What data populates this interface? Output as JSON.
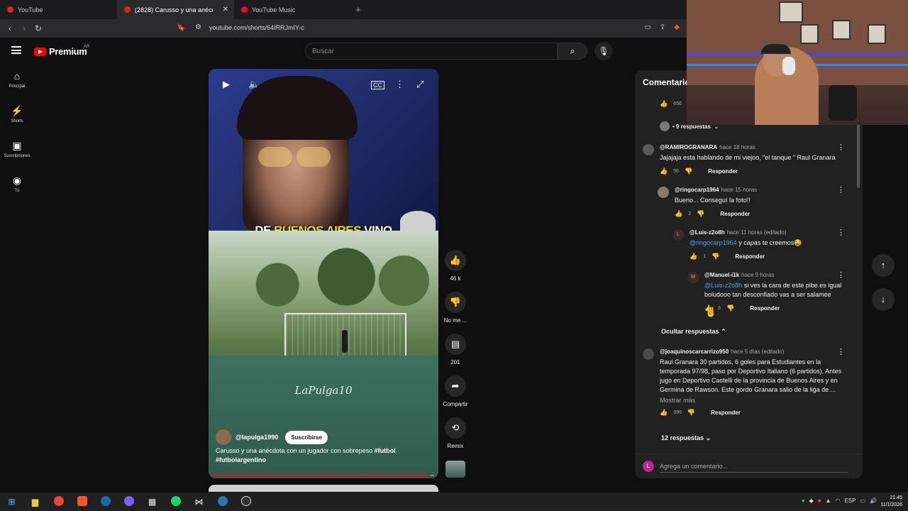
{
  "browser": {
    "tabs": [
      {
        "label": "YouTube"
      },
      {
        "label": "(2828) Carusso y una anécdota c"
      },
      {
        "label": "YouTube Music"
      }
    ],
    "url": "youtube.com/shorts/64IRRJmIY-c"
  },
  "header": {
    "logo": "Premium",
    "logo_region": "AR",
    "search_placeholder": "Buscar"
  },
  "sidebar": {
    "items": [
      {
        "label": "Principal",
        "icon": "home-icon"
      },
      {
        "label": "Shorts",
        "icon": "shorts-icon"
      },
      {
        "label": "Suscripciones",
        "icon": "subscriptions-icon"
      },
      {
        "label": "Tú",
        "icon": "you-icon"
      }
    ]
  },
  "video": {
    "caption_pre": "DE",
    "caption_highlight": "BUENOS AIRES",
    "caption_post": "VINO",
    "watermark": "LaPulga10",
    "channel": "@lapulga1990",
    "subscribe": "Suscribirse",
    "title_text": "Carusso y una anécdota con un jugador con sobrepeso",
    "title_tag1": "#futbol",
    "title_tag2": "#futbolargentino",
    "progress": 0.98
  },
  "actions": {
    "likes": "46 k",
    "dislike": "No me ...",
    "comments": "201",
    "share": "Compartir",
    "remix": "Remix"
  },
  "comments": {
    "title": "Comentarios",
    "top_likes": "656",
    "top_replies": "• 9 respuestas",
    "reply_label": "Responder",
    "hide_replies": "Ocultar respuestas",
    "more_replies": "12 respuestas",
    "show_more": "Mostrar más",
    "input_placeholder": "Agrega un comentario...",
    "input_avatar": "L",
    "items": [
      {
        "user": "@RAMIROGRANARA",
        "time": "hace 18 horas",
        "text": "Jajajaja esta hablando de mi viejoo, \"el tanque \" Raul Granara",
        "likes": "56"
      },
      {
        "user": "@ringocarp1964",
        "time": "hace 15 horas",
        "text": "Bueno... Conseguí la foto!!",
        "likes": "2"
      },
      {
        "user": "@Luis-z2o8h",
        "time": "hace 11 horas (editado)",
        "mention": "@ringocarp1964",
        "text": "y capas te creemos😂",
        "likes": "1",
        "avatar": "L"
      },
      {
        "user": "@Manuel-i1k",
        "time": "hace 9 horas",
        "mention": "@Luis-z2o8h",
        "text": "si ves la cara de este pibe es igual boludooo tan desconfiado vas a ser salamee",
        "likes": "5",
        "avatar": "M"
      },
      {
        "user": "@joaquinoscarcarrizo950",
        "time": "hace 5 días (editado)",
        "text": "Raul Granara 30 partidos, 6 goles para Estudiantes en la temporada 97/98,  paso por Deportivo Italiano (6 partidos). Antes jugo en Deportivo Castelli de la provincia de Buenos Aires y en Germina de Rawson. Este gordo Granara salio de la liga de ...",
        "likes": "399"
      }
    ]
  },
  "taskbar": {
    "time": "21:45",
    "date": "11/1/2026",
    "lang": "ESP"
  }
}
